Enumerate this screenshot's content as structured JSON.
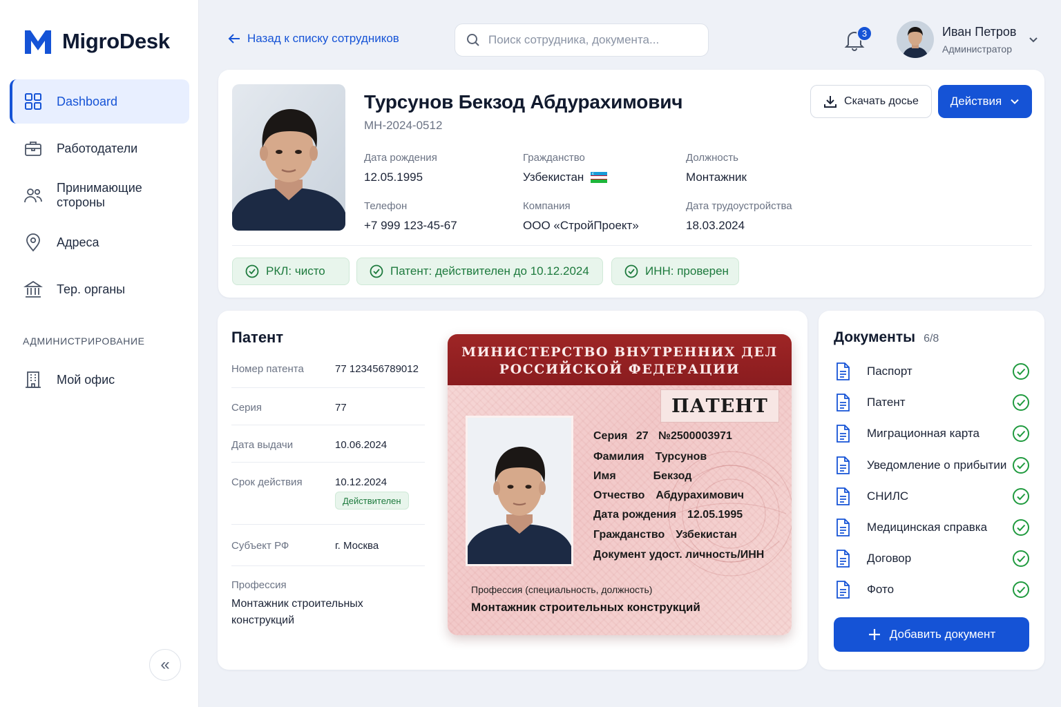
{
  "app": {
    "name": "MigroDesk",
    "brand_color": "#1553d6"
  },
  "sidebar": {
    "items": [
      {
        "label": "Dashboard",
        "icon": "grid-icon",
        "active": true
      },
      {
        "label": "Работодатели",
        "icon": "briefcase-icon"
      },
      {
        "label": "Принимающие стороны",
        "icon": "users-icon"
      },
      {
        "label": "Адреса",
        "icon": "map-pin-icon"
      },
      {
        "label": "Тер. органы",
        "icon": "building-columns-icon"
      }
    ],
    "section_label": "АДМИНИСТРИРОВАНИЕ",
    "admin_items": [
      {
        "label": "Мой офис",
        "icon": "office-building-icon"
      }
    ],
    "collapse_label": "«"
  },
  "topbar": {
    "back_label": "Назад к списку сотрудников",
    "search_placeholder": "Поиск сотрудника, документа...",
    "notifications_count": "3",
    "user": {
      "name": "Иван Петров",
      "role": "Администратор"
    }
  },
  "profile": {
    "name": "Турсунов Бекзод Абдурахимович",
    "id": "МН-2024-0512",
    "fields": {
      "birth": {
        "label": "Дата рождения",
        "value": "12.05.1995"
      },
      "citizenship": {
        "label": "Гражданство",
        "value": "Узбекистан"
      },
      "position": {
        "label": "Должность",
        "value": "Монтажник"
      },
      "phone": {
        "label": "Телефон",
        "value": "+7 999 123-45-67"
      },
      "company": {
        "label": "Компания",
        "value": "ООО «СтройПроект»"
      },
      "hired": {
        "label": "Дата трудоустройства",
        "value": "18.03.2024"
      }
    },
    "download_label": "Скачать досье",
    "actions_label": "Действия",
    "chips": [
      "РКЛ: чисто",
      "Патент: действителен до 10.12.2024",
      "ИНН: проверен"
    ]
  },
  "patent": {
    "title": "Патент",
    "rows": [
      {
        "label": "Номер патента",
        "value": "77 123456789012"
      },
      {
        "label": "Серия",
        "value": "77"
      },
      {
        "label": "Дата выдачи",
        "value": "10.06.2024"
      },
      {
        "label": "Срок действия",
        "value": "10.12.2024",
        "badge": "Действителен"
      },
      {
        "label": "Субъект РФ",
        "value": "г. Москва"
      }
    ],
    "profession_label": "Профессия",
    "profession_value": "Монтажник строительных конструкций",
    "document": {
      "header_line1": "МИНИСТЕРСТВО ВНУТРЕННИХ ДЕЛ",
      "header_line2": "РОССИЙСКОЙ ФЕДЕРАЦИИ",
      "title": "ПАТЕНТ",
      "series_label": "Серия",
      "series_value": "27",
      "number": "№2500003971",
      "lines": [
        {
          "label": "Фамилия",
          "value": "Турсунов"
        },
        {
          "label": "Имя",
          "value": "Бекзод"
        },
        {
          "label": "Отчество",
          "value": "Абдурахимович"
        },
        {
          "label": "Дата рождения",
          "value": "12.05.1995"
        },
        {
          "label": "Гражданство",
          "value": "Узбекистан"
        },
        {
          "label": "Документ удост. личность/ИНН",
          "value": ""
        }
      ],
      "profession_label": "Профессия (специальность, должность)",
      "profession_value": "Монтажник строительных конструкций"
    }
  },
  "documents": {
    "title": "Документы",
    "count": "6/8",
    "items": [
      "Паспорт",
      "Патент",
      "Миграционная карта",
      "Уведомление о прибытии",
      "СНИЛС",
      "Медицинская справка",
      "Договор",
      "Фото"
    ],
    "add_label": "Добавить документ"
  }
}
